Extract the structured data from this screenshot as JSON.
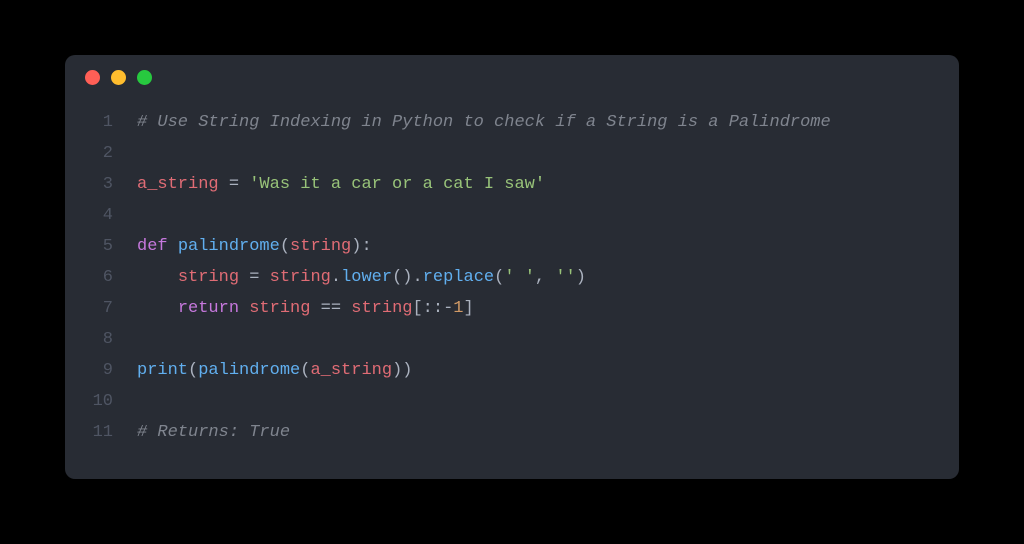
{
  "window": {
    "dots": {
      "red": "#ff5f56",
      "yellow": "#ffbd2e",
      "green": "#27c93f"
    }
  },
  "code": {
    "lines": [
      {
        "n": "1",
        "tokens": [
          {
            "cls": "tok-comment",
            "t": "# Use String Indexing in Python to check if a String is a Palindrome"
          }
        ]
      },
      {
        "n": "2",
        "tokens": [
          {
            "cls": "",
            "t": ""
          }
        ]
      },
      {
        "n": "3",
        "tokens": [
          {
            "cls": "tok-ident",
            "t": "a_string"
          },
          {
            "cls": "tok-op",
            "t": " = "
          },
          {
            "cls": "tok-string",
            "t": "'Was it a car or a cat I saw'"
          }
        ]
      },
      {
        "n": "4",
        "tokens": [
          {
            "cls": "",
            "t": ""
          }
        ]
      },
      {
        "n": "5",
        "tokens": [
          {
            "cls": "tok-kw",
            "t": "def "
          },
          {
            "cls": "tok-func",
            "t": "palindrome"
          },
          {
            "cls": "tok-punct",
            "t": "("
          },
          {
            "cls": "tok-ident",
            "t": "string"
          },
          {
            "cls": "tok-punct",
            "t": "):"
          }
        ]
      },
      {
        "n": "6",
        "tokens": [
          {
            "cls": "",
            "t": "    "
          },
          {
            "cls": "tok-ident",
            "t": "string"
          },
          {
            "cls": "tok-op",
            "t": " = "
          },
          {
            "cls": "tok-ident",
            "t": "string"
          },
          {
            "cls": "tok-punct",
            "t": "."
          },
          {
            "cls": "tok-call",
            "t": "lower"
          },
          {
            "cls": "tok-punct",
            "t": "()."
          },
          {
            "cls": "tok-call",
            "t": "replace"
          },
          {
            "cls": "tok-punct",
            "t": "("
          },
          {
            "cls": "tok-string",
            "t": "' '"
          },
          {
            "cls": "tok-punct",
            "t": ", "
          },
          {
            "cls": "tok-string",
            "t": "''"
          },
          {
            "cls": "tok-punct",
            "t": ")"
          }
        ]
      },
      {
        "n": "7",
        "tokens": [
          {
            "cls": "",
            "t": "    "
          },
          {
            "cls": "tok-kw",
            "t": "return"
          },
          {
            "cls": "",
            "t": " "
          },
          {
            "cls": "tok-ident",
            "t": "string"
          },
          {
            "cls": "tok-op",
            "t": " == "
          },
          {
            "cls": "tok-ident",
            "t": "string"
          },
          {
            "cls": "tok-punct",
            "t": "[::"
          },
          {
            "cls": "tok-op",
            "t": "-"
          },
          {
            "cls": "tok-num",
            "t": "1"
          },
          {
            "cls": "tok-punct",
            "t": "]"
          }
        ]
      },
      {
        "n": "8",
        "tokens": [
          {
            "cls": "",
            "t": ""
          }
        ]
      },
      {
        "n": "9",
        "tokens": [
          {
            "cls": "tok-call",
            "t": "print"
          },
          {
            "cls": "tok-punct",
            "t": "("
          },
          {
            "cls": "tok-call",
            "t": "palindrome"
          },
          {
            "cls": "tok-punct",
            "t": "("
          },
          {
            "cls": "tok-ident",
            "t": "a_string"
          },
          {
            "cls": "tok-punct",
            "t": "))"
          }
        ]
      },
      {
        "n": "10",
        "tokens": [
          {
            "cls": "",
            "t": ""
          }
        ]
      },
      {
        "n": "11",
        "tokens": [
          {
            "cls": "tok-comment",
            "t": "# Returns: True"
          }
        ]
      }
    ]
  }
}
